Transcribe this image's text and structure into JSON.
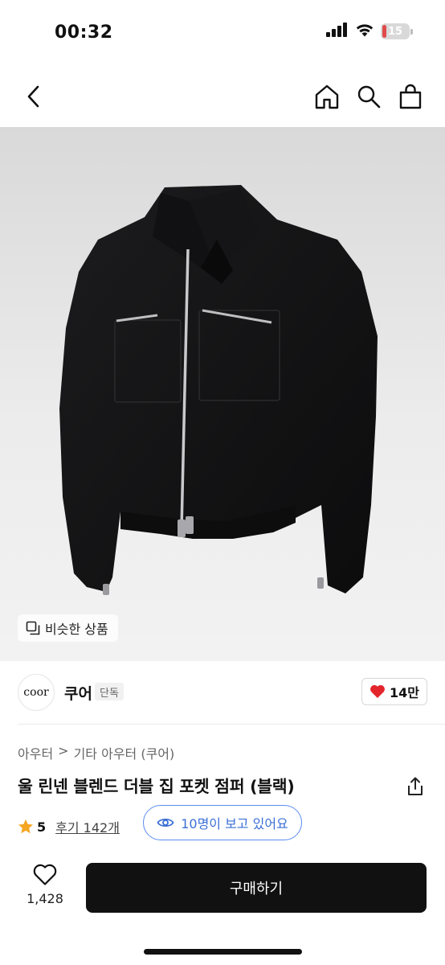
{
  "status_bar": {
    "time": "00:32",
    "battery": "15",
    "battery_level": 0.15,
    "battery_color": "#e04a4a"
  },
  "nav": {
    "icons": [
      "back-chevron-icon",
      "home-icon",
      "search-icon",
      "shopping-bag-icon"
    ]
  },
  "hero": {
    "image": "black-zip-jacket",
    "similar_label": "비슷한 상품"
  },
  "brand": {
    "logo_text": "coor",
    "name": "쿠어",
    "badge": "단독",
    "likes": "14만",
    "like_color": "#e3262c"
  },
  "breadcrumb": {
    "level1": "아우터",
    "separator": ">",
    "level2": "기타 아우터 (쿠어)"
  },
  "product": {
    "title": "울 린넨 블렌드 더블 집 포켓 점퍼 (블랙)"
  },
  "rating": {
    "score": "5",
    "reviews": "후기 142개",
    "star_color": "#f5a623"
  },
  "viewers": {
    "text": "10명이 보고 있어요",
    "accent": "#3b6fd6"
  },
  "bottom": {
    "wish_count": "1,428",
    "buy_label": "구매하기"
  }
}
